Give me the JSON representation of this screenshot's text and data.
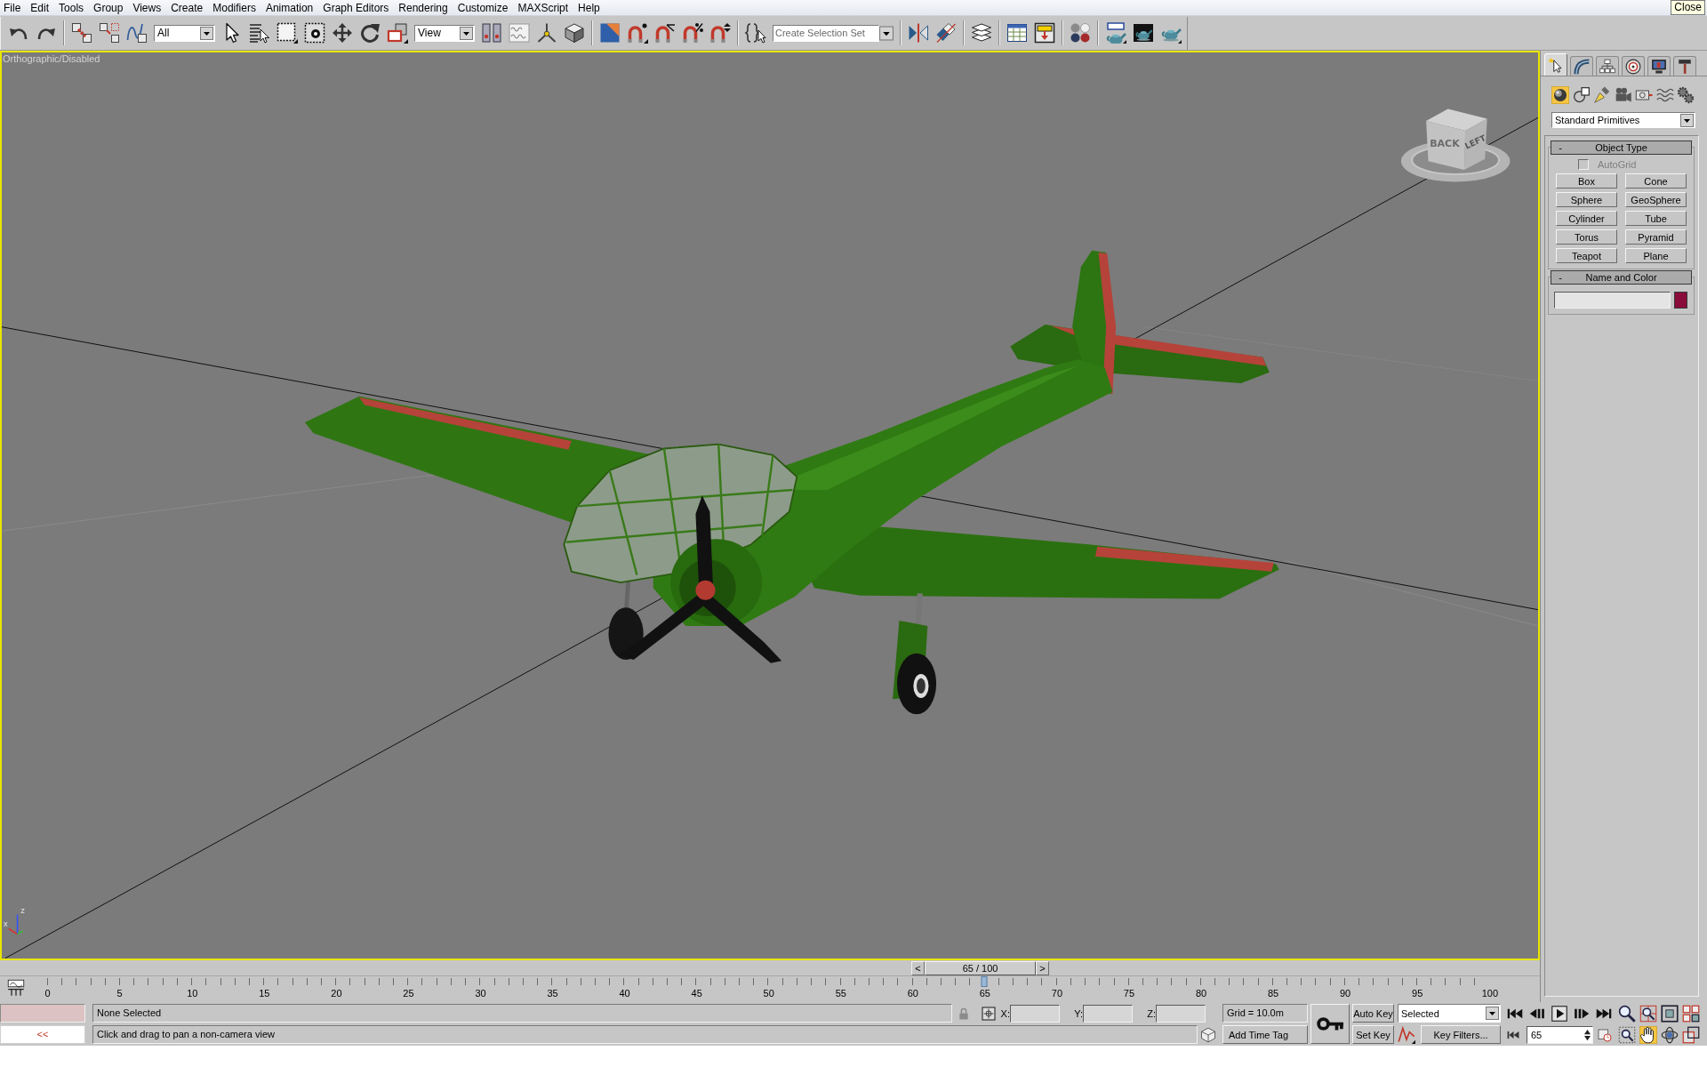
{
  "menu_bar": {
    "items": [
      "File",
      "Edit",
      "Tools",
      "Group",
      "Views",
      "Create",
      "Modifiers",
      "Animation",
      "Graph Editors",
      "Rendering",
      "Customize",
      "MAXScript",
      "Help"
    ],
    "tooltip": "Close"
  },
  "toolbar": {
    "selection_filter": "All",
    "reference_coordinate_system": "View",
    "named_selection_set": {
      "placeholder": "Create Selection Set"
    }
  },
  "viewport": {
    "label": "Orthographic/Disabled",
    "active": true,
    "view_cube": {
      "faces": [
        "BACK",
        "LEFT"
      ]
    },
    "axis_labels": [
      "z",
      "x"
    ]
  },
  "time_slider": {
    "previous": "<",
    "label": "65 / 100",
    "next": ">",
    "level": 0.65
  },
  "track_bar": {
    "labels": [
      "0",
      "5",
      "10",
      "15",
      "20",
      "25",
      "30",
      "35",
      "40",
      "45",
      "50",
      "55",
      "60",
      "65",
      "70",
      "75",
      "80",
      "85",
      "90",
      "95",
      "100"
    ],
    "level": 0.65
  },
  "command_panel": {
    "tabs": [
      {
        "selected": true
      },
      {
        "selected": false
      },
      {
        "selected": false
      },
      {
        "selected": false
      },
      {
        "selected": false
      },
      {
        "selected": false
      }
    ],
    "categories": [
      {
        "selected": true
      },
      {
        "selected": false
      },
      {
        "selected": false
      },
      {
        "selected": false
      },
      {
        "selected": false
      },
      {
        "selected": false
      },
      {
        "selected": false
      }
    ],
    "dropdown": "Standard Primitives",
    "object_type": {
      "toggle": "-",
      "title": "Object Type",
      "autogrid": {
        "label": "AutoGrid",
        "checked": false,
        "disabled": true
      },
      "buttons": [
        "Box",
        "Cone",
        "Sphere",
        "GeoSphere",
        "Cylinder",
        "Tube",
        "Torus",
        "Pyramid",
        "Teapot",
        "Plane"
      ]
    },
    "name_and_color": {
      "toggle": "-",
      "title": "Name and Color",
      "color": "#8a0c3a"
    }
  },
  "status_bar": {
    "listener": "<<",
    "selection": "None Selected",
    "prompt": "Click and drag to pan a non-camera view",
    "coordinates": [
      {
        "label": "X:"
      },
      {
        "label": "Y:"
      },
      {
        "label": "Z:"
      }
    ],
    "grid": "Grid = 10.0m",
    "time_tag": "Add Time Tag",
    "auto_key": {
      "label": "Auto Key",
      "on": false
    },
    "set_key": "Set Key",
    "key_filter_set": "Selected",
    "key_filters": "Key Filters...",
    "frame": "65",
    "navigation": [
      {
        "selected": false
      },
      {
        "selected": false
      },
      {
        "selected": false
      },
      {
        "selected": false
      },
      {
        "selected": false
      },
      {
        "selected": true
      },
      {
        "selected": false
      },
      {
        "selected": false
      }
    ]
  }
}
